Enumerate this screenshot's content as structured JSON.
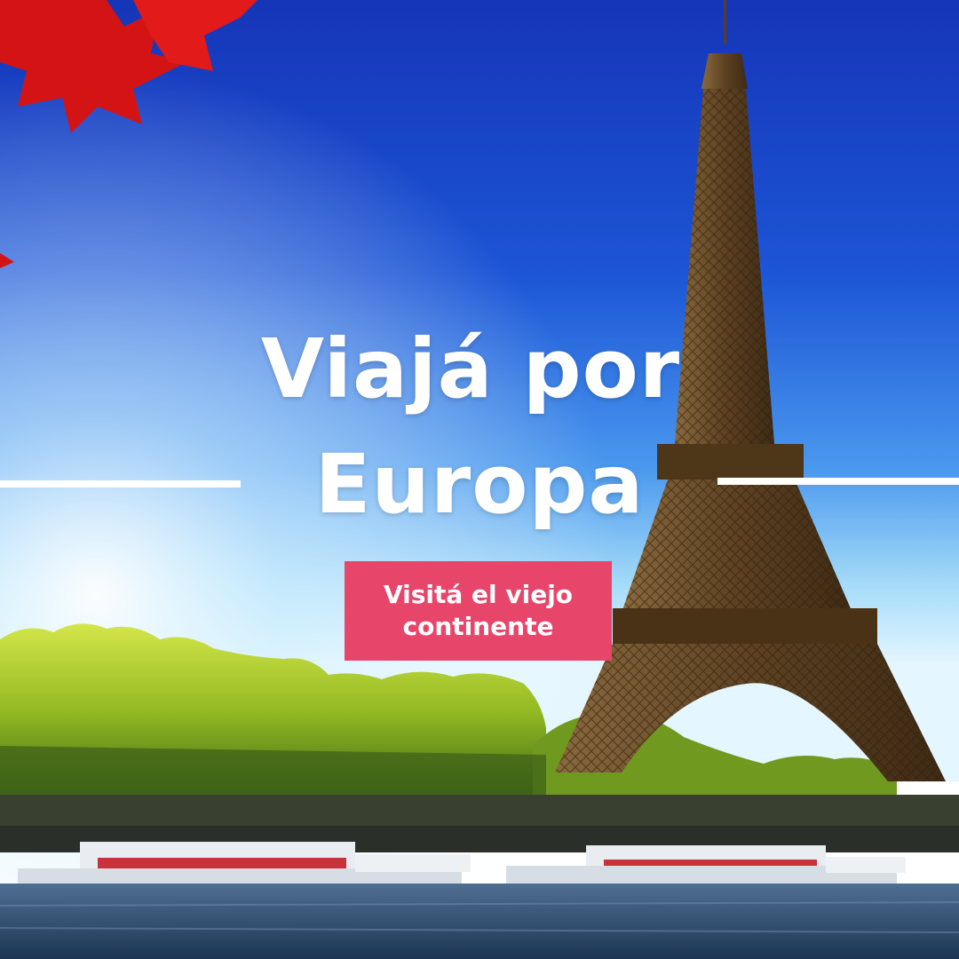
{
  "headline": {
    "line1": "Viajá por",
    "line2": "Europa"
  },
  "cta": {
    "label": "Visitá el viejo continente"
  },
  "colors": {
    "sky_top": "#1a3fc8",
    "sky_horizon": "#c9eefc",
    "cta_background": "#e8456a",
    "text": "#ffffff",
    "tower": "#6b4a2b",
    "leaves": "#d41414",
    "trees": "#8fb51e",
    "water": "#2b4a6e"
  }
}
